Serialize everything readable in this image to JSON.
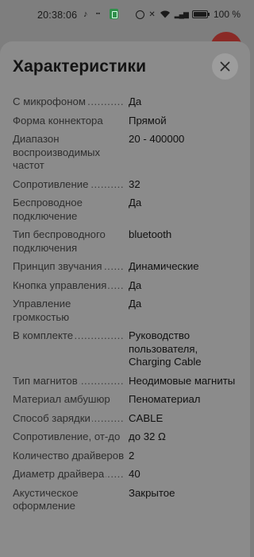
{
  "status_bar": {
    "time": "20:38:06",
    "battery": "100 %",
    "left_icons": [
      "tiktok-icon",
      "km-icon",
      "app-icon"
    ],
    "right_icons": [
      "alarm-icon",
      "mute-icon",
      "wifi-icon",
      "signal-icon",
      "battery-icon"
    ]
  },
  "sheet": {
    "title": "Характеристики",
    "close_icon": "close-icon"
  },
  "specs": [
    {
      "label": "С микрофоном",
      "value": "Да",
      "dots": true
    },
    {
      "label": "Форма коннектора",
      "value": "Прямой",
      "dots": false
    },
    {
      "label": "Диапазон воспроизводимых частот",
      "value": "20 - 400000",
      "dots": false
    },
    {
      "label": "Сопротивление",
      "value": "32",
      "dots": true
    },
    {
      "label": "Беспроводное подключение",
      "value": "Да",
      "dots": false
    },
    {
      "label": "Тип беспроводного подключения",
      "value": "bluetooth",
      "dots": false
    },
    {
      "label": "Принцип звучания",
      "value": "Динамические",
      "dots": true
    },
    {
      "label": "Кнопка управления",
      "value": "Да",
      "dots": true
    },
    {
      "label": "Управление громкостью",
      "value": "Да",
      "dots": false
    },
    {
      "label": "В комплекте",
      "value": "Руководство пользователя, Charging Cable",
      "dots": true
    },
    {
      "label": "Тип магнитов",
      "value": "Неодимовые магниты",
      "dots": true
    },
    {
      "label": "Материал амбушюр",
      "value": "Пеноматериал",
      "dots": false
    },
    {
      "label": "Способ зарядки",
      "value": "CABLE",
      "dots": true
    },
    {
      "label": "Сопротивление, от-до",
      "value": "до 32 Ω",
      "dots": false
    },
    {
      "label": "Количество драйверов",
      "value": "2",
      "dots": false
    },
    {
      "label": "Диаметр драйвера",
      "value": "40",
      "dots": true
    },
    {
      "label": "Акустическое оформление",
      "value": "Закрытое",
      "dots": false
    }
  ]
}
